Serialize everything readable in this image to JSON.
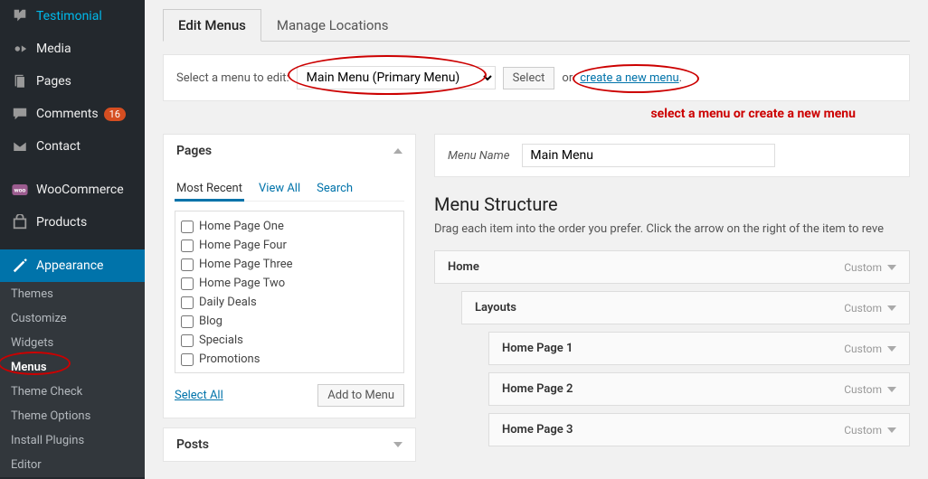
{
  "sidebar": {
    "items": [
      {
        "label": "Testimonial",
        "icon": "testimonial"
      },
      {
        "label": "Media",
        "icon": "media"
      },
      {
        "label": "Pages",
        "icon": "pages"
      },
      {
        "label": "Comments",
        "icon": "comments",
        "badge": "16"
      },
      {
        "label": "Contact",
        "icon": "contact"
      },
      {
        "label": "WooCommerce",
        "icon": "woo"
      },
      {
        "label": "Products",
        "icon": "products"
      },
      {
        "label": "Appearance",
        "icon": "appearance",
        "active": true
      }
    ],
    "submenu": [
      "Themes",
      "Customize",
      "Widgets",
      "Menus",
      "Theme Check",
      "Theme Options",
      "Install Plugins",
      "Editor"
    ],
    "submenu_current": "Menus"
  },
  "tabs": [
    "Edit Menus",
    "Manage Locations"
  ],
  "active_tab": "Edit Menus",
  "select_row": {
    "label": "Select a menu to edit:",
    "selected": "Main Menu (Primary Menu)",
    "select_btn": "Select",
    "or_text": "or",
    "create_link": "create a new menu",
    "period": "."
  },
  "annotation": "select a menu or create a new menu",
  "pages_panel": {
    "title": "Pages",
    "tabs": [
      "Most Recent",
      "View All",
      "Search"
    ],
    "active": "Most Recent",
    "items": [
      "Home Page One",
      "Home Page Four",
      "Home Page Three",
      "Home Page Two",
      "Daily Deals",
      "Blog",
      "Specials",
      "Promotions"
    ],
    "select_all": "Select All",
    "add_btn": "Add to Menu"
  },
  "posts_panel": {
    "title": "Posts"
  },
  "menu_name": {
    "label": "Menu Name",
    "value": "Main Menu"
  },
  "structure": {
    "heading": "Menu Structure",
    "desc": "Drag each item into the order you prefer. Click the arrow on the right of the item to reve",
    "items": [
      {
        "label": "Home",
        "type": "Custom",
        "indent": 0
      },
      {
        "label": "Layouts",
        "type": "Custom",
        "indent": 1
      },
      {
        "label": "Home Page 1",
        "type": "Custom",
        "indent": 2
      },
      {
        "label": "Home Page 2",
        "type": "Custom",
        "indent": 2
      },
      {
        "label": "Home Page 3",
        "type": "Custom",
        "indent": 2
      }
    ]
  }
}
